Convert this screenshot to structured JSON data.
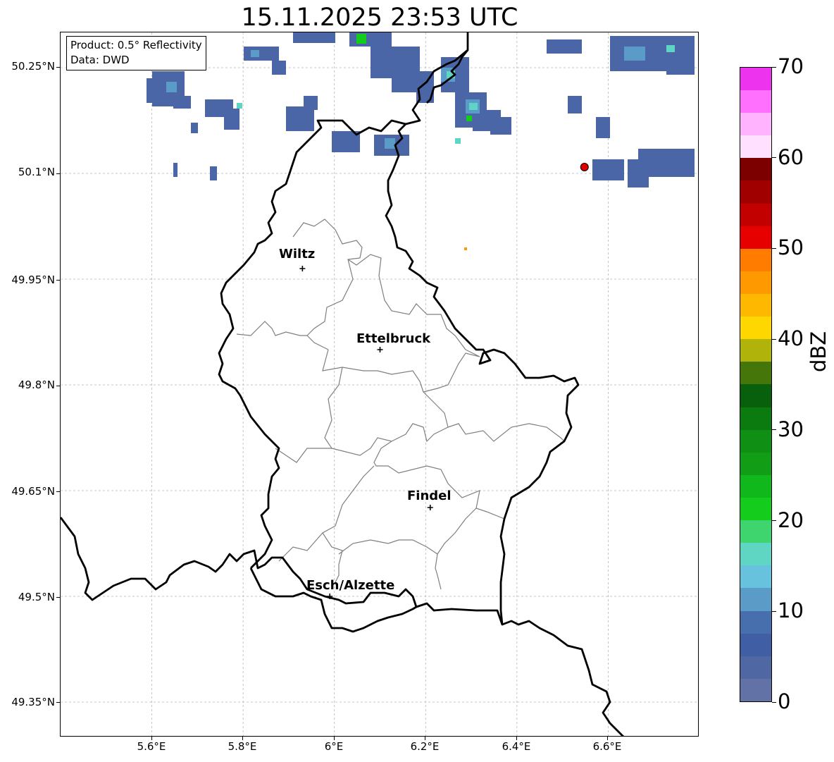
{
  "title": "15.11.2025 23:53 UTC",
  "info": {
    "product": "Product: 0.5° Reflectivity",
    "data_source": "Data: DWD"
  },
  "axes": {
    "lat_labels": [
      "50.25°N",
      "50.1°N",
      "49.95°N",
      "49.8°N",
      "49.65°N",
      "49.5°N",
      "49.35°N"
    ],
    "lon_labels": [
      "5.6°E",
      "5.8°E",
      "6°E",
      "6.2°E",
      "6.4°E",
      "6.6°E"
    ],
    "lon_range": [
      5.4,
      6.8
    ],
    "lat_range": [
      49.3,
      50.3
    ],
    "gridlines": true
  },
  "cities": [
    {
      "name": "Wiltz",
      "lon": 5.93,
      "lat": 49.965
    },
    {
      "name": "Ettelbruck",
      "lon": 6.1,
      "lat": 49.85
    },
    {
      "name": "Findel",
      "lon": 6.21,
      "lat": 49.626
    },
    {
      "name": "Esch/Alzette",
      "lon": 5.99,
      "lat": 49.5
    }
  ],
  "radar_site": {
    "lon": 6.548,
    "lat": 50.109,
    "color": "#e00000"
  },
  "colorbar": {
    "label": "dBZ",
    "min": 0,
    "max": 70,
    "tick_labels": [
      "0",
      "10",
      "20",
      "30",
      "40",
      "50",
      "60",
      "70"
    ],
    "colors": [
      "#6272a6",
      "#4f67a3",
      "#3f5ea4",
      "#476fad",
      "#5a9bc8",
      "#67c2dd",
      "#5fd6c3",
      "#3fd56e",
      "#14cc1c",
      "#10b81b",
      "#119e16",
      "#0f8f14",
      "#0b7b10",
      "#08600c",
      "#44760a",
      "#b0b30a",
      "#ffd700",
      "#ffb800",
      "#ff9900",
      "#ff7c00",
      "#e60000",
      "#c20000",
      "#a00000",
      "#7d0000",
      "#ffe0ff",
      "#ffb3ff",
      "#ff70ff",
      "#ee33ee"
    ]
  }
}
